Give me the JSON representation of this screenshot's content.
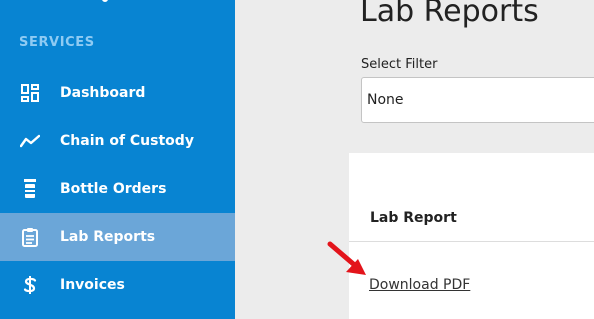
{
  "sidebar": {
    "section_label": "SERVICES",
    "items": [
      {
        "label": "Dashboard",
        "icon": "dashboard-icon",
        "active": false
      },
      {
        "label": "Chain of Custody",
        "icon": "trend-line-icon",
        "active": false
      },
      {
        "label": "Bottle Orders",
        "icon": "bottle-icon",
        "active": false
      },
      {
        "label": "Lab Reports",
        "icon": "clipboard-icon",
        "active": true
      },
      {
        "label": "Invoices",
        "icon": "dollar-icon",
        "active": false
      }
    ]
  },
  "main": {
    "title": "Lab Reports",
    "filter": {
      "label": "Select Filter",
      "value": "None"
    },
    "table": {
      "column_header": "Lab Report",
      "rows": [
        {
          "link_label": "Download PDF"
        }
      ]
    }
  },
  "colors": {
    "sidebar_bg": "#0884d2",
    "sidebar_active_bg": "#6ba6d8",
    "section_label": "#8fcbf3",
    "page_bg": "#ececec",
    "annotation_arrow": "#e3141b"
  }
}
